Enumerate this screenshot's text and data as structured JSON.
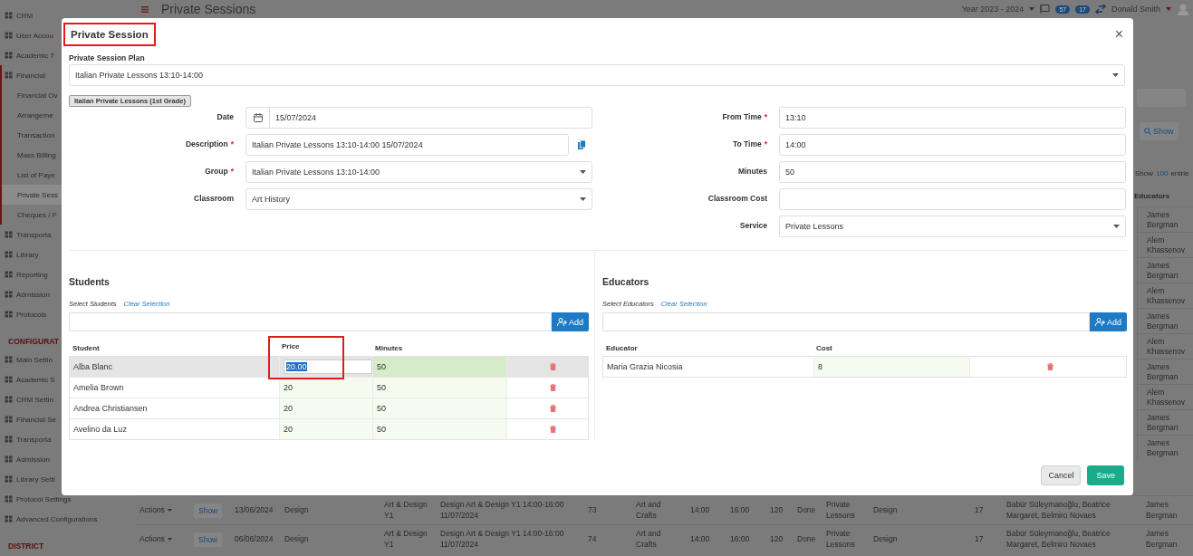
{
  "sidebar": {
    "sections": [
      {
        "items": [
          {
            "label": "CRM",
            "selected": false
          },
          {
            "label": "User Accou",
            "selected": false
          },
          {
            "label": "Academic T",
            "selected": false
          },
          {
            "label": "Financial",
            "selected": false,
            "expanded": true,
            "children": [
              {
                "label": "Financial Ov",
                "selected": false
              },
              {
                "label": "Arrangeme",
                "selected": false
              },
              {
                "label": "Transaction",
                "selected": false
              },
              {
                "label": "Mass Billing",
                "selected": false
              },
              {
                "label": "List of Paye",
                "selected": false
              },
              {
                "label": "Private Sess",
                "selected": true
              },
              {
                "label": "Cheques / F",
                "selected": false
              }
            ]
          },
          {
            "label": "Transporta",
            "selected": false
          },
          {
            "label": "Library",
            "selected": false
          },
          {
            "label": "Reporting",
            "selected": false
          },
          {
            "label": "Admission",
            "selected": false
          },
          {
            "label": "Protocols",
            "selected": false
          }
        ]
      },
      {
        "title": "CONFIGURAT",
        "items": [
          {
            "label": "Main Settin",
            "selected": false
          },
          {
            "label": "Academic S",
            "selected": false
          },
          {
            "label": "CRM Settin",
            "selected": false
          },
          {
            "label": "Financial Se",
            "selected": false
          },
          {
            "label": "Transporta",
            "selected": false
          },
          {
            "label": "Admission",
            "selected": false
          },
          {
            "label": "Library Setti",
            "selected": false
          },
          {
            "label": "Protocol Settings",
            "selected": false
          },
          {
            "label": "Advanced Configurations",
            "selected": false
          }
        ]
      },
      {
        "title": "DISTRICT"
      }
    ]
  },
  "header": {
    "title": "Private Sessions",
    "year": "Year 2023 - 2024",
    "badges": [
      "57",
      "17"
    ],
    "user": "Donald Smith"
  },
  "list": {
    "show_button": "Show",
    "entries": {
      "label": "Show",
      "count": "100",
      "suffix": "entrie"
    },
    "column": "Educators",
    "rows": [
      {
        "educators": "James Bergman"
      },
      {
        "educators": "Alem Khassenov"
      },
      {
        "educators": "James Bergman"
      },
      {
        "educators": "Alem Khassenov"
      },
      {
        "educators": "James Bergman"
      },
      {
        "educators": "Alem Khassenov"
      },
      {
        "educators": "James Bergman"
      },
      {
        "educators": "Alem Khassenov"
      },
      {
        "educators": "James Bergman"
      },
      {
        "educators": "James Bergman"
      },
      {
        "actions": "Actions",
        "show": "Show",
        "cells": [
          "13/06/2024",
          "Design",
          "Art & Design Y1",
          "Design Art & Design Y1 14:00-16:00 11/07/2024",
          "73",
          "Art and Crafts",
          "14:00",
          "16:00",
          "120",
          "Done",
          "Private Lessons",
          "Design",
          "17",
          "Babür Süleymanoğlu, Beatrice Margaret, Belmiro Novaes"
        ],
        "educators": "James Bergman"
      },
      {
        "actions": "Actions",
        "show": "Show",
        "cells": [
          "06/06/2024",
          "Design",
          "Art & Design Y1",
          "Design Art & Design Y1 14:00-16:00 11/07/2024",
          "74",
          "Art and Crafts",
          "14:00",
          "16:00",
          "120",
          "Done",
          "Private Lessons",
          "Design",
          "17",
          "Babür Süleymanoğlu, Beatrice Margaret, Belmiro Novaes"
        ],
        "educators": "James Bergman"
      }
    ]
  },
  "modal": {
    "title": "Private Session",
    "title_highlighted": true,
    "close": "×",
    "required_mark": "*",
    "plan": {
      "label": "Private Session Plan",
      "value": "Italian Private Lessons 13:10-14:00"
    },
    "tag": "Italian Private Lessons (1st Grade)",
    "left_fields": [
      {
        "kind": "date",
        "label": "Date",
        "required": false,
        "value": "15/07/2024"
      },
      {
        "kind": "copy",
        "label": "Description",
        "required": true,
        "value": "Italian Private Lessons  13:10-14:00 15/07/2024"
      },
      {
        "kind": "select",
        "label": "Group",
        "required": true,
        "value": "Italian Private Lessons 13:10-14:00"
      },
      {
        "kind": "select",
        "label": "Classroom",
        "required": false,
        "value": "Art History"
      }
    ],
    "right_fields": [
      {
        "kind": "text",
        "label": "From Time",
        "required": true,
        "value": "13:10"
      },
      {
        "kind": "text",
        "label": "To Time",
        "required": true,
        "value": "14:00"
      },
      {
        "kind": "text",
        "label": "Minutes",
        "required": false,
        "value": "50"
      },
      {
        "kind": "text",
        "label": "Classroom Cost",
        "required": false
      },
      {
        "kind": "select",
        "label": "Service",
        "required": false,
        "value": "Private Lessons"
      }
    ],
    "students": {
      "title": "Students",
      "select_label": "Select Students",
      "clear": "Clear Selection",
      "add": "Add",
      "columns": [
        {
          "label": "Student",
          "highlighted": false
        },
        {
          "label": "Price",
          "highlighted": true
        },
        {
          "label": "Minutes",
          "highlighted": false
        }
      ],
      "rows": [
        {
          "name": "Alba Blanc",
          "price": "20.00",
          "minutes": "50",
          "selected": true,
          "editing": true
        },
        {
          "name": "Amelia Brown",
          "price": "20",
          "minutes": "50",
          "selected": false,
          "editing": false
        },
        {
          "name": "Andrea Christiansen",
          "price": "20",
          "minutes": "50",
          "selected": false,
          "editing": false
        },
        {
          "name": "Avelino da Luz",
          "price": "20",
          "minutes": "50",
          "selected": false,
          "editing": false
        }
      ]
    },
    "educators": {
      "title": "Educators",
      "select_label": "Select Educators",
      "clear": "Clear Selection",
      "add": "Add",
      "columns": [
        {
          "label": "Educator"
        },
        {
          "label": "Cost"
        }
      ],
      "rows": [
        {
          "name": "Maria Grazia Nicosia",
          "cost": "8"
        }
      ]
    },
    "buttons": [
      {
        "kind": "secondary",
        "label": "Cancel"
      },
      {
        "kind": "primary",
        "label": "Save"
      }
    ]
  }
}
